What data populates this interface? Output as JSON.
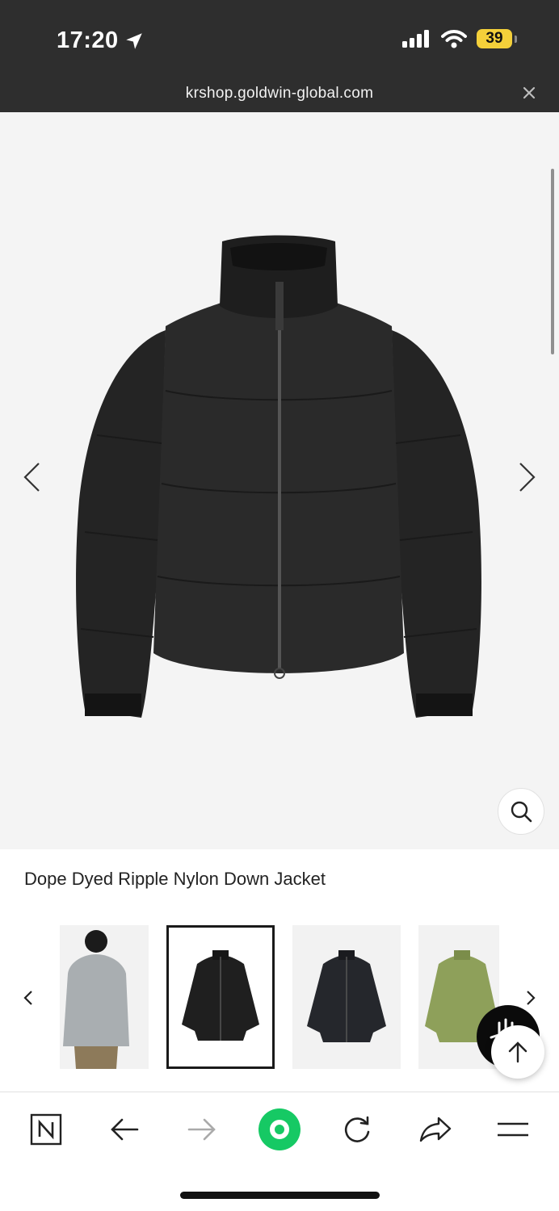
{
  "status_bar": {
    "time": "17:20",
    "battery": "39"
  },
  "browser": {
    "url": "krshop.goldwin-global.com"
  },
  "product": {
    "title": "Dope Dyed Ripple Nylon Down Jacket"
  },
  "thumbnails": [
    {
      "color": "#9ea3a6",
      "selected": false
    },
    {
      "color": "#1f1f1f",
      "selected": true
    },
    {
      "color": "#24262b",
      "selected": false
    },
    {
      "color": "#8ea05a",
      "selected": false
    }
  ],
  "colors": {
    "accent_green": "#16c964",
    "status_bg": "#2e2e2e",
    "hero_bg": "#f4f4f4"
  },
  "icons": {
    "status": [
      "location-arrow-icon",
      "signal-icon",
      "wifi-icon",
      "battery-icon"
    ],
    "toolbar": [
      "naver-n-icon",
      "back-arrow-icon",
      "forward-arrow-icon",
      "green-home-icon",
      "reload-icon",
      "share-icon",
      "menu-icon"
    ]
  }
}
